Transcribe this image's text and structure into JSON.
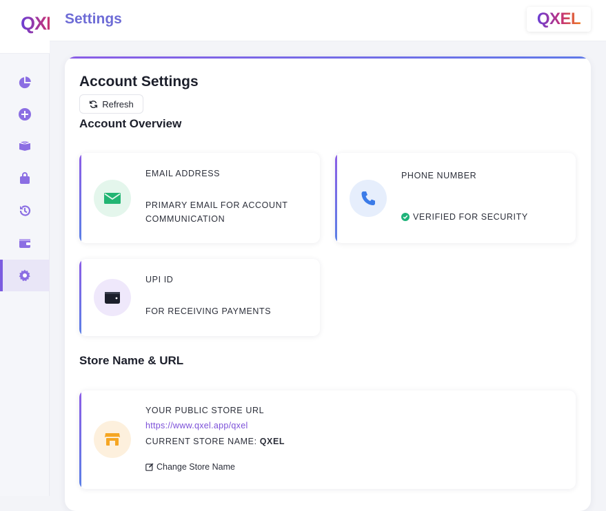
{
  "app": {
    "logo_text": "QXEL",
    "brand_badge_text": "QXEL",
    "page_title": "Settings"
  },
  "sidebar": {
    "items": [
      {
        "icon": "pie-chart-icon",
        "label": "",
        "active": false
      },
      {
        "icon": "plus-circle-icon",
        "label": "",
        "active": false
      },
      {
        "icon": "box-icon",
        "label": "",
        "active": false
      },
      {
        "icon": "shopping-bag-icon",
        "label": "",
        "active": false
      },
      {
        "icon": "history-icon",
        "label": "",
        "active": false
      },
      {
        "icon": "wallet-icon",
        "label": "",
        "active": false
      },
      {
        "icon": "gear-icon",
        "label": "",
        "active": true
      }
    ]
  },
  "account": {
    "title": "Account Settings",
    "refresh_label": "Refresh",
    "overview_title": "Account Overview",
    "email": {
      "label": "EMAIL ADDRESS",
      "desc_line1": "PRIMARY EMAIL FOR ACCOUNT",
      "desc_line2": "COMMUNICATION"
    },
    "phone": {
      "label": "PHONE NUMBER",
      "verified_text": "VERIFIED FOR SECURITY"
    },
    "upi": {
      "label": "UPI ID",
      "desc": "FOR RECEIVING PAYMENTS"
    }
  },
  "store": {
    "section_title": "Store Name & URL",
    "url_label": "YOUR PUBLIC STORE URL",
    "url": "https://www.qxel.app/qxel",
    "current_name_label": "CURRENT STORE NAME:",
    "current_name": "QXEL",
    "change_label": "Change Store Name"
  },
  "colors": {
    "accent": "#7c5ce0",
    "title_purple": "#6e6cd6",
    "email_icon": "#22b573",
    "phone_icon": "#3b7be8",
    "store_icon": "#f5a623",
    "verified": "#1fb37a"
  }
}
